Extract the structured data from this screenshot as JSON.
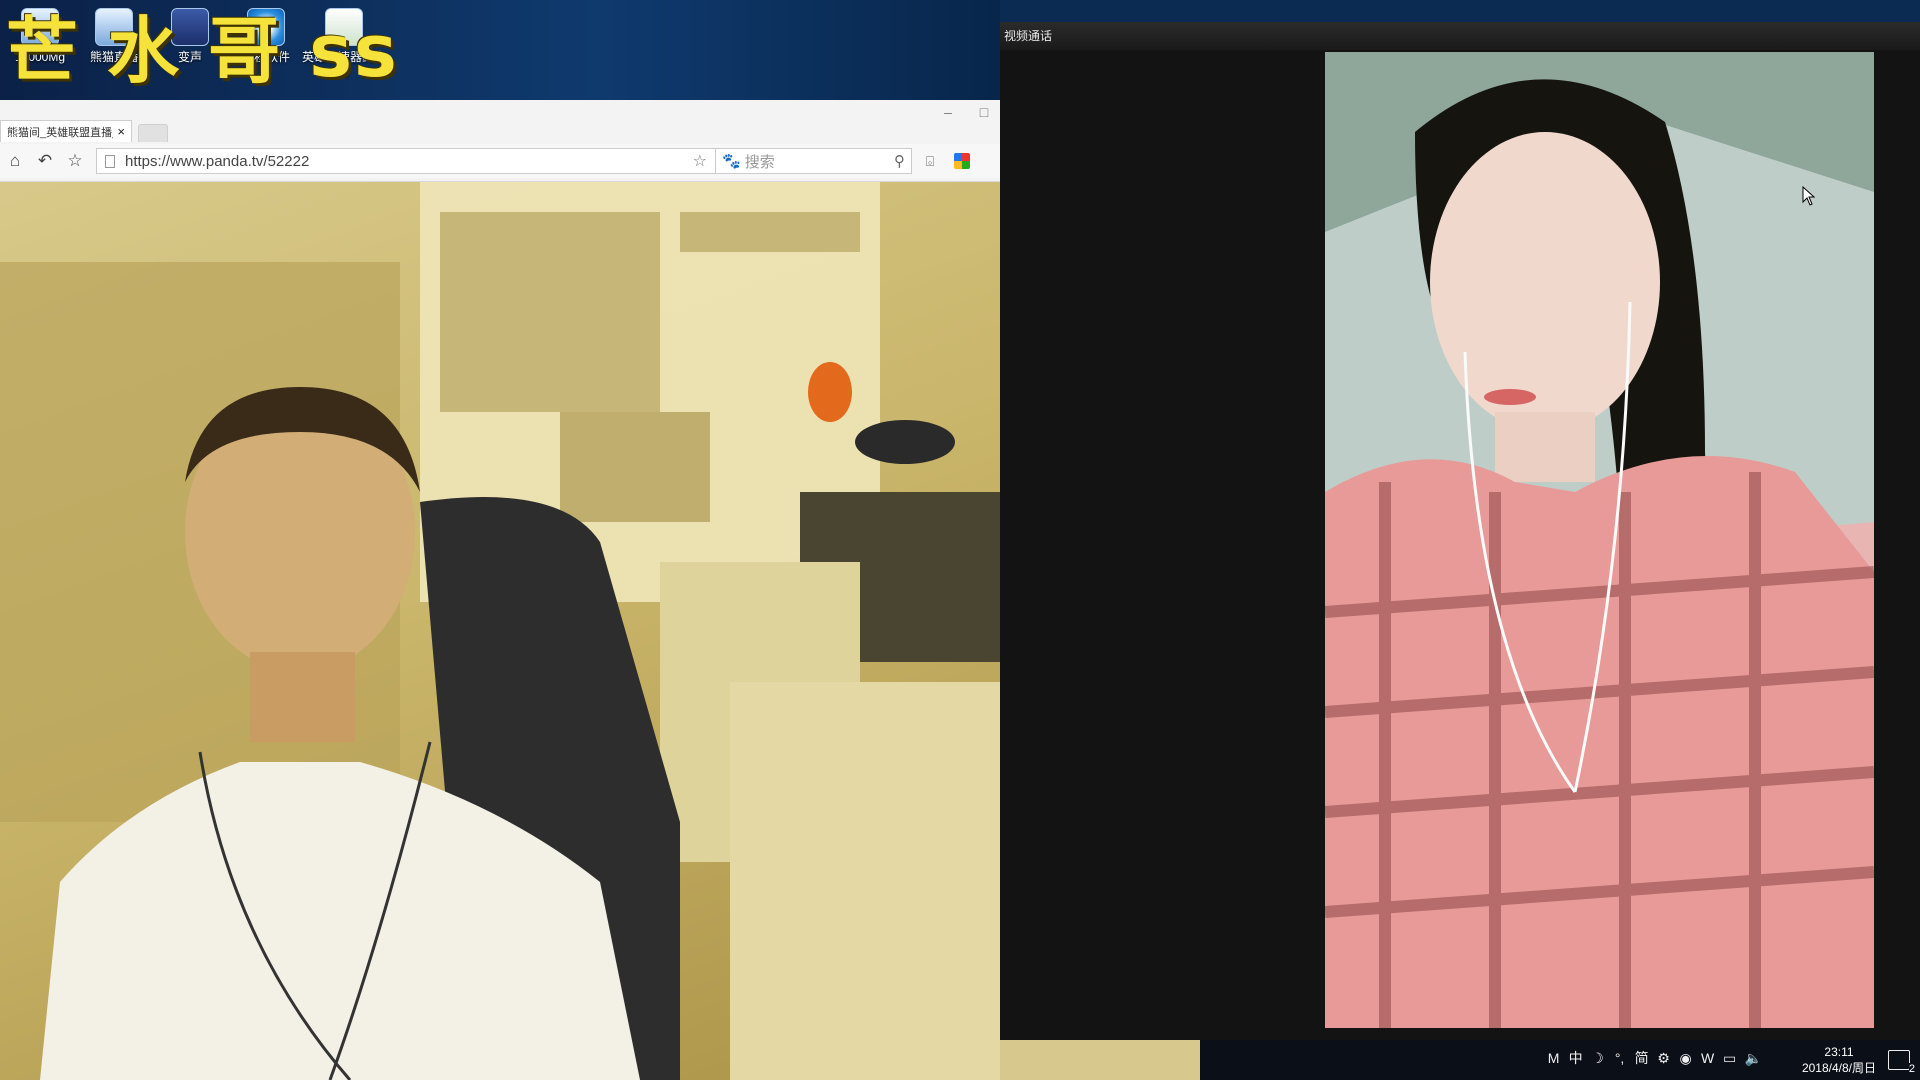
{
  "desktop": {
    "overlay_title": "芒 水 哥 ss",
    "icons": [
      {
        "label": "10000Mg",
        "icon": "computer-icon"
      },
      {
        "label": "熊猫直播",
        "icon": "panda-tv-icon"
      },
      {
        "label": "变声",
        "icon": "voice-changer-icon"
      },
      {
        "label": "远程软件",
        "icon": "remote-desktop-icon"
      },
      {
        "label": "英雄加速器药水哥",
        "icon": "spreadsheet-icon"
      }
    ]
  },
  "browser": {
    "tab_title": "熊猫间_英雄联盟直播_",
    "tab_close": "×",
    "url": "https://www.panda.tv/52222",
    "search_placeholder": "搜索",
    "window_controls": [
      "–",
      "□"
    ]
  },
  "video_call": {
    "title": "视频通话"
  },
  "taskbar": {
    "tray_icons": [
      "M",
      "中",
      "☽",
      "°,",
      "简",
      "⚙",
      "◉",
      "W",
      "▭",
      "🔈"
    ],
    "time": "23:11",
    "date": "2018/4/8/周日",
    "notifications_count": "2"
  }
}
